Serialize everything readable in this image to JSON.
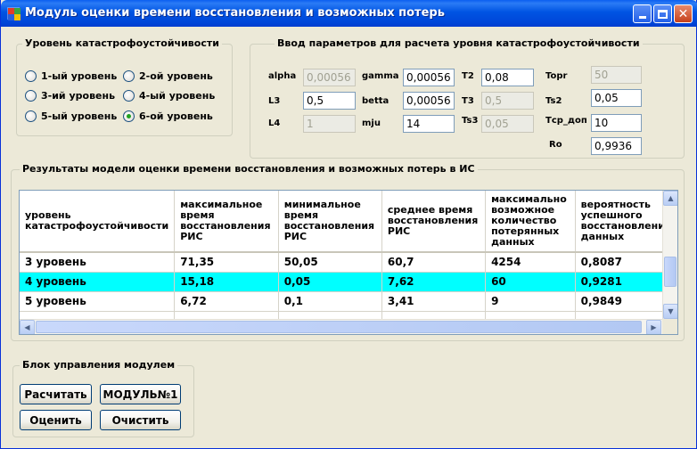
{
  "window": {
    "title": "Модуль оценки времени восстановления и возможных потерь"
  },
  "levels_group": {
    "legend": "Уровень катастрофоустойчивости",
    "options": [
      {
        "label": "1-ый уровень",
        "checked": false
      },
      {
        "label": "2-ой уровень",
        "checked": false
      },
      {
        "label": "3-ий уровень",
        "checked": false
      },
      {
        "label": "4-ый уровень",
        "checked": false
      },
      {
        "label": "5-ый уровень",
        "checked": false
      },
      {
        "label": "6-ой уровень",
        "checked": true
      }
    ]
  },
  "params_group": {
    "legend": "Ввод параметров для расчета уровня катастрофоустойчивости",
    "fields": {
      "alpha": {
        "label": "alpha",
        "value": "0,00056",
        "enabled": false
      },
      "gamma": {
        "label": "gamma",
        "value": "0,00056",
        "enabled": true
      },
      "T2": {
        "label": "T2",
        "value": "0,08",
        "enabled": true
      },
      "Topr": {
        "label": "Topr",
        "value": "50",
        "enabled": false
      },
      "L3": {
        "label": "L3",
        "value": "0,5",
        "enabled": true
      },
      "betta": {
        "label": "betta",
        "value": "0,00056",
        "enabled": true
      },
      "T3": {
        "label": "T3",
        "value": "0,5",
        "enabled": false
      },
      "Ts2": {
        "label": "Ts2",
        "value": "0,05",
        "enabled": true
      },
      "L4": {
        "label": "L4",
        "value": "1",
        "enabled": false
      },
      "mju": {
        "label": "mju",
        "value": "14",
        "enabled": true
      },
      "Ts3": {
        "label": "Ts3",
        "value": "0,05",
        "enabled": false
      },
      "Tcr_dop": {
        "label": "Тср_доп",
        "value": "10",
        "enabled": true
      },
      "Ro": {
        "label": "Ro",
        "value": "0,9936",
        "enabled": true
      }
    }
  },
  "results_group": {
    "legend": "Результаты модели оценки времени восстановления и возможных потерь в ИС",
    "columns": [
      "уровень катастрофоустойчивости",
      "максимальное время восстановления РИС",
      "минимальное время восстановления РИС",
      "среднее время восстановления РИС",
      "максимально возможное количество потерянных данных",
      "вероятность успешного восстановления данных"
    ],
    "rows": [
      {
        "cells": [
          "3 уровень",
          "71,35",
          "50,05",
          "60,7",
          "4254",
          "0,8087"
        ],
        "selected": false
      },
      {
        "cells": [
          "4 уровень",
          "15,18",
          "0,05",
          "7,62",
          "60",
          "0,9281"
        ],
        "selected": true
      },
      {
        "cells": [
          "5 уровень",
          "6,72",
          "0,1",
          "3,41",
          "9",
          "0,9849"
        ],
        "selected": false
      },
      {
        "cells": [
          "",
          "",
          "",
          "",
          "",
          ""
        ],
        "selected": false
      }
    ]
  },
  "control_group": {
    "legend": "Блок управления модулем",
    "buttons": {
      "calculate": "Расчитать",
      "module1": "МОДУЛЬ№1",
      "evaluate": "Оценить",
      "clear": "Очистить"
    }
  }
}
